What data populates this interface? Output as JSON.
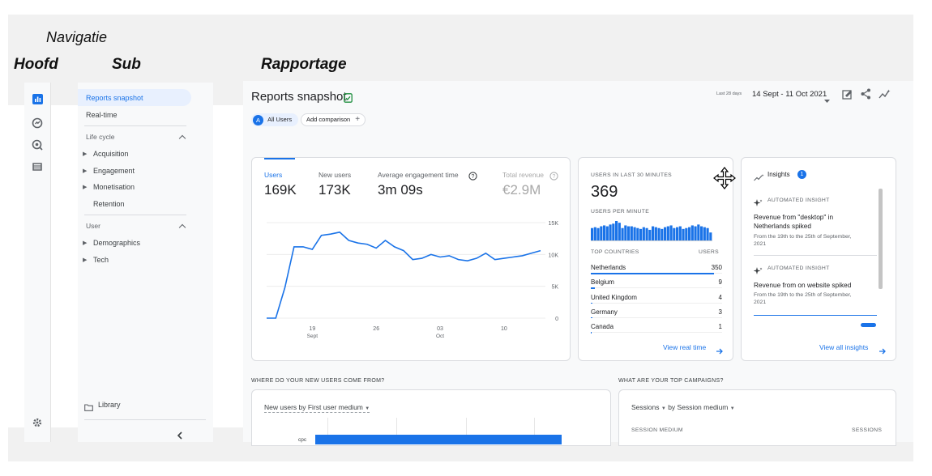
{
  "labels": {
    "navigatie": "Navigatie",
    "hoofd": "Hoofd",
    "sub": "Sub",
    "rapportage": "Rapportage"
  },
  "rail_icons": [
    "bar-chart-icon",
    "realtime-gauge-icon",
    "explore-icon",
    "table-icon",
    "gear-icon"
  ],
  "subnav": {
    "reports_snapshot": "Reports snapshot",
    "real_time": "Real-time",
    "life_cycle": "Life cycle",
    "acquisition": "Acquisition",
    "engagement": "Engagement",
    "monetisation": "Monetisation",
    "retention": "Retention",
    "user": "User",
    "demographics": "Demographics",
    "tech": "Tech",
    "library": "Library"
  },
  "header": {
    "title": "Reports snapshot",
    "date_label": "Last 28 days",
    "date_range": "14 Sept - 11 Oct 2021",
    "all_users_avatar": "A",
    "all_users": "All Users",
    "add_comparison": "Add comparison"
  },
  "metrics": [
    {
      "label": "Users",
      "value": "169K"
    },
    {
      "label": "New users",
      "value": "173K"
    },
    {
      "label": "Average engagement time",
      "value": "3m 09s"
    },
    {
      "label": "Total revenue",
      "value": "€2.9M"
    }
  ],
  "chart_data": {
    "type": "line",
    "x_ticks": [
      {
        "label": "19",
        "sub": "Sept"
      },
      {
        "label": "26",
        "sub": ""
      },
      {
        "label": "03",
        "sub": "Oct"
      },
      {
        "label": "10",
        "sub": ""
      }
    ],
    "y_ticks": [
      "15K",
      "10K",
      "5K",
      "0"
    ],
    "ylim": [
      0,
      15000
    ],
    "values": [
      0,
      0,
      4800,
      11200,
      11200,
      10800,
      13000,
      13200,
      13500,
      12200,
      11800,
      11600,
      11000,
      12200,
      11200,
      10600,
      9200,
      9400,
      10000,
      9600,
      9800,
      9200,
      9000,
      9400,
      10200,
      9200,
      9400,
      9600,
      9800,
      10200,
      10600
    ],
    "line_color": "#1a73e8"
  },
  "realtime": {
    "title": "USERS IN LAST 30 MINUTES",
    "value": "369",
    "per_minute_label": "USERS PER MINUTE",
    "bars": [
      14,
      15,
      14,
      16,
      17,
      16,
      18,
      19,
      22,
      20,
      14,
      17,
      16,
      16,
      15,
      14,
      13,
      15,
      14,
      12,
      16,
      15,
      14,
      13,
      15,
      16,
      17,
      14,
      15,
      16,
      13,
      14,
      15,
      17,
      16,
      18,
      16,
      15,
      14,
      9
    ],
    "countries_header": "TOP COUNTRIES",
    "users_header": "USERS",
    "countries": [
      {
        "name": "Netherlands",
        "value": "350",
        "share": 1.0
      },
      {
        "name": "Belgium",
        "value": "9",
        "share": 0.03
      },
      {
        "name": "United Kingdom",
        "value": "4",
        "share": 0.015
      },
      {
        "name": "Germany",
        "value": "3",
        "share": 0.01
      },
      {
        "name": "Canada",
        "value": "1",
        "share": 0.005
      }
    ],
    "view_link": "View real time"
  },
  "insights": {
    "title": "Insights",
    "badge": "1",
    "items": [
      {
        "kind": "AUTOMATED INSIGHT",
        "line1": "Revenue from \"desktop\" in",
        "line2": "Netherlands spiked",
        "sub1": "From the 19th to the 25th of September,",
        "sub2": "2021"
      },
      {
        "kind": "AUTOMATED INSIGHT",
        "line1": "Revenue from on website spiked",
        "line2": "",
        "sub1": "From the 19th to the 25th of September,",
        "sub2": "2021"
      }
    ],
    "view_link": "View all insights"
  },
  "bottom": {
    "q_left": "WHERE DO YOUR NEW USERS COME FROM?",
    "q_right": "WHAT ARE YOUR TOP CAMPAIGNS?",
    "left_selector_a": "New users",
    "left_selector_b": "by First user medium",
    "cpc_label": "cpc",
    "right_selector_a": "Sessions",
    "right_selector_b": "by Session medium",
    "session_medium": "SESSION MEDIUM",
    "sessions": "SESSIONS"
  },
  "colors": {
    "accent": "#1a73e8",
    "active_bg": "#e8f0fe",
    "success": "#1e8e3e"
  }
}
